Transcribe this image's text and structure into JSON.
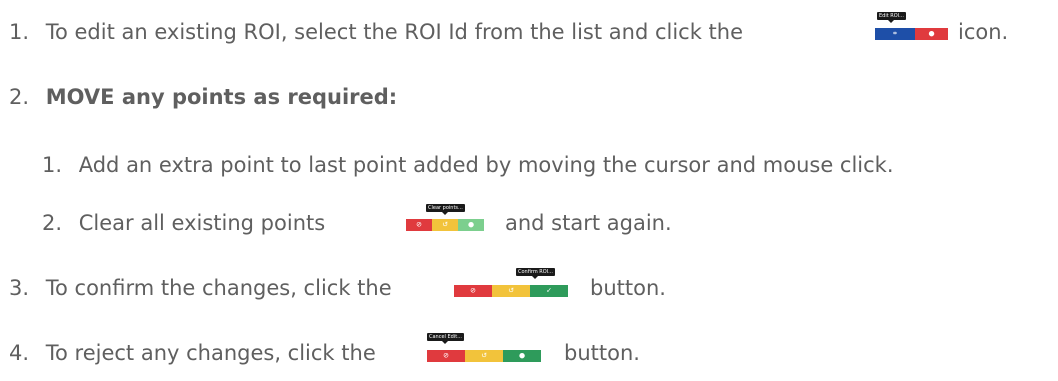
{
  "steps": [
    {
      "num": "1.",
      "before": "To edit an existing ROI, select the ROI Id from the list and click the",
      "after": "icon."
    },
    {
      "num": "2.",
      "text": "MOVE any points as required:"
    },
    {
      "num": "3.",
      "before": "To confirm the changes, click the",
      "after": "button."
    },
    {
      "num": "4.",
      "before": "To reject any changes, click the",
      "after": "button."
    }
  ],
  "substeps": [
    {
      "num": "1.",
      "text": "Add an extra point to last point added by moving the cursor and mouse click."
    },
    {
      "num": "2.",
      "before": "Clear all existing points",
      "after": "and start again."
    }
  ],
  "tooltips": {
    "edit_roi": "Edit ROI...",
    "clear_points": "Clear points...",
    "confirm_roi": "Confirm ROI...",
    "cancel_edit": "Cancel Edit..."
  },
  "icons": {
    "edit": "edit-icon",
    "delete": "trash-icon",
    "clear": "clear-icon",
    "undo": "undo-icon",
    "confirm": "check-icon",
    "cancel": "cancel-icon"
  },
  "colors": {
    "text": "#5f5f5f",
    "blue": "#1e4fa8",
    "red": "#e03a3e",
    "yellow": "#f2c33b",
    "green": "#2e9b5b",
    "light_green": "#7ccf8e",
    "tooltip": "#1a1a1a"
  }
}
